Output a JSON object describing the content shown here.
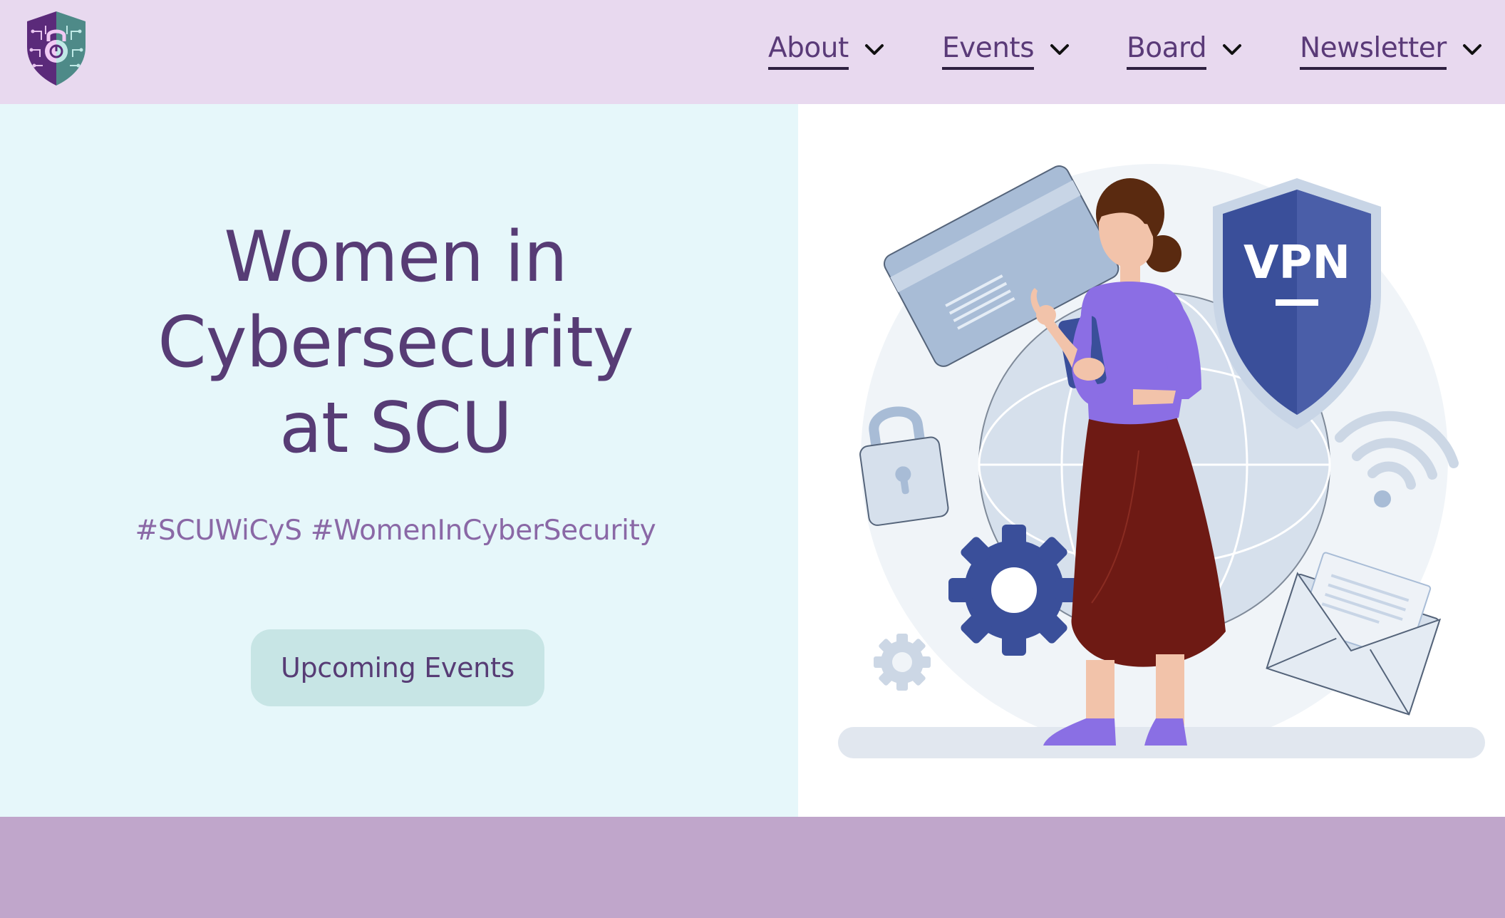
{
  "header": {
    "logo_icon": "shield-lock-circuit-icon",
    "nav": [
      {
        "label": "About",
        "icon": "chevron-down-icon"
      },
      {
        "label": "Events",
        "icon": "chevron-down-icon"
      },
      {
        "label": "Board",
        "icon": "chevron-down-icon"
      },
      {
        "label": "Newsletter",
        "icon": "chevron-down-icon"
      }
    ]
  },
  "hero": {
    "title_lines": [
      "Women in",
      "Cybersecurity",
      "at SCU"
    ],
    "hashtags": "#SCUWiCyS #WomenInCyberSecurity",
    "cta_label": "Upcoming Events",
    "illustration": {
      "shield_text": "VPN",
      "icons": [
        "credit-card-icon",
        "padlock-icon",
        "gear-icon",
        "wifi-icon",
        "envelope-icon",
        "globe-icon",
        "vpn-shield-icon",
        "person-with-phone-icon"
      ]
    }
  },
  "colors": {
    "header_bg": "#e8d9ef",
    "hero_left_bg": "#e6f7fa",
    "title_purple": "#573c75",
    "hashtag_purple": "#8a68a6",
    "button_bg": "#c7e5e5",
    "bottom_band": "#c0a6cb",
    "vpn_blue": "#3a4f9a"
  }
}
